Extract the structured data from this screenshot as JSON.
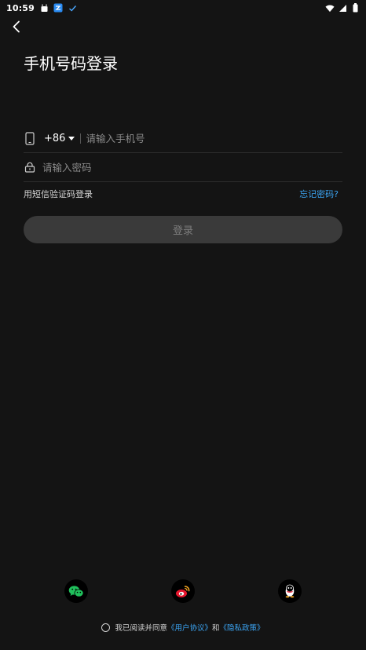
{
  "status_bar": {
    "time": "10:59",
    "left_icons": [
      "android-notify-icon",
      "app-notify-icon",
      "check-notify-icon"
    ],
    "right_icons": [
      "wifi-icon",
      "signal-icon",
      "battery-icon"
    ]
  },
  "header": {
    "back_icon": "chevron-left-icon",
    "title": "手机号码登录"
  },
  "form": {
    "phone": {
      "icon": "phone-icon",
      "country_code": "+86",
      "value": "",
      "placeholder": "请输入手机号"
    },
    "password": {
      "icon": "lock-icon",
      "value": "",
      "placeholder": "请输入密码"
    },
    "sms_login_label": "用短信验证码登录",
    "forgot_label": "忘记密码?",
    "login_label": "登录"
  },
  "social": [
    {
      "name": "wechat",
      "icon": "wechat-icon",
      "color": "#20c05c"
    },
    {
      "name": "weibo",
      "icon": "weibo-icon",
      "color": "#e6162d"
    },
    {
      "name": "qq",
      "icon": "qq-icon",
      "color": "#ffffff"
    }
  ],
  "agreement": {
    "prefix": "我已阅读并同意",
    "user_agreement": "《用户协议》",
    "conjunction": "和",
    "privacy_policy": "《隐私政策》"
  },
  "colors": {
    "background": "#141414",
    "accent": "#3ba4f2",
    "button_disabled_bg": "#3a3a3a",
    "button_disabled_text": "#7d7d7d"
  }
}
